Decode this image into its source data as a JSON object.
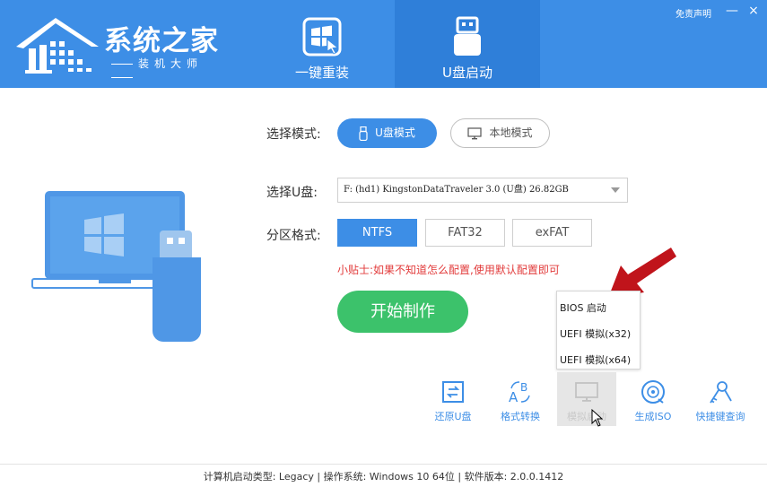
{
  "header": {
    "brand_title": "系统之家",
    "brand_subtitle": "装机大师",
    "tabs": [
      {
        "label": "一键重装",
        "icon": "windows-cursor-icon",
        "active": false
      },
      {
        "label": "U盘启动",
        "icon": "usb-drive-icon",
        "active": true
      }
    ],
    "disclaimer_link": "免责声明",
    "minimize_label": "—",
    "close_label": "×"
  },
  "form": {
    "mode_label": "选择模式:",
    "mode_options": [
      {
        "label": "U盘模式",
        "icon": "usb-icon",
        "selected": true
      },
      {
        "label": "本地模式",
        "icon": "monitor-icon",
        "selected": false
      }
    ],
    "usb_label": "选择U盘:",
    "usb_value": "F: (hd1) KingstonDataTraveler 3.0 (U盘) 26.82GB",
    "partition_label": "分区格式:",
    "partition_options": [
      {
        "label": "NTFS",
        "selected": true
      },
      {
        "label": "FAT32",
        "selected": false
      },
      {
        "label": "exFAT",
        "selected": false
      }
    ],
    "tip": "小贴士:如果不知道怎么配置,使用默认配置即可",
    "start_button": "开始制作"
  },
  "boot_menu": {
    "items": [
      "BIOS 启动",
      "UEFI 模拟(x32)",
      "UEFI 模拟(x64)"
    ]
  },
  "tools": [
    {
      "label": "还原U盘",
      "icon": "restore-icon"
    },
    {
      "label": "格式转换",
      "icon": "format-convert-icon"
    },
    {
      "label": "模拟启动",
      "icon": "simulate-boot-icon"
    },
    {
      "label": "生成ISO",
      "icon": "iso-disc-icon"
    },
    {
      "label": "快捷键查询",
      "icon": "shortcut-key-icon"
    }
  ],
  "footer": {
    "text": "计算机启动类型: Legacy | 操作系统: Windows 10 64位 | 软件版本: 2.0.0.1412"
  },
  "colors": {
    "header_blue": "#3d8ee6",
    "active_tab_blue": "#2f7fd9",
    "start_green": "#3cc26b",
    "tip_red": "#e23b3b",
    "arrow_red": "#c0141b"
  }
}
